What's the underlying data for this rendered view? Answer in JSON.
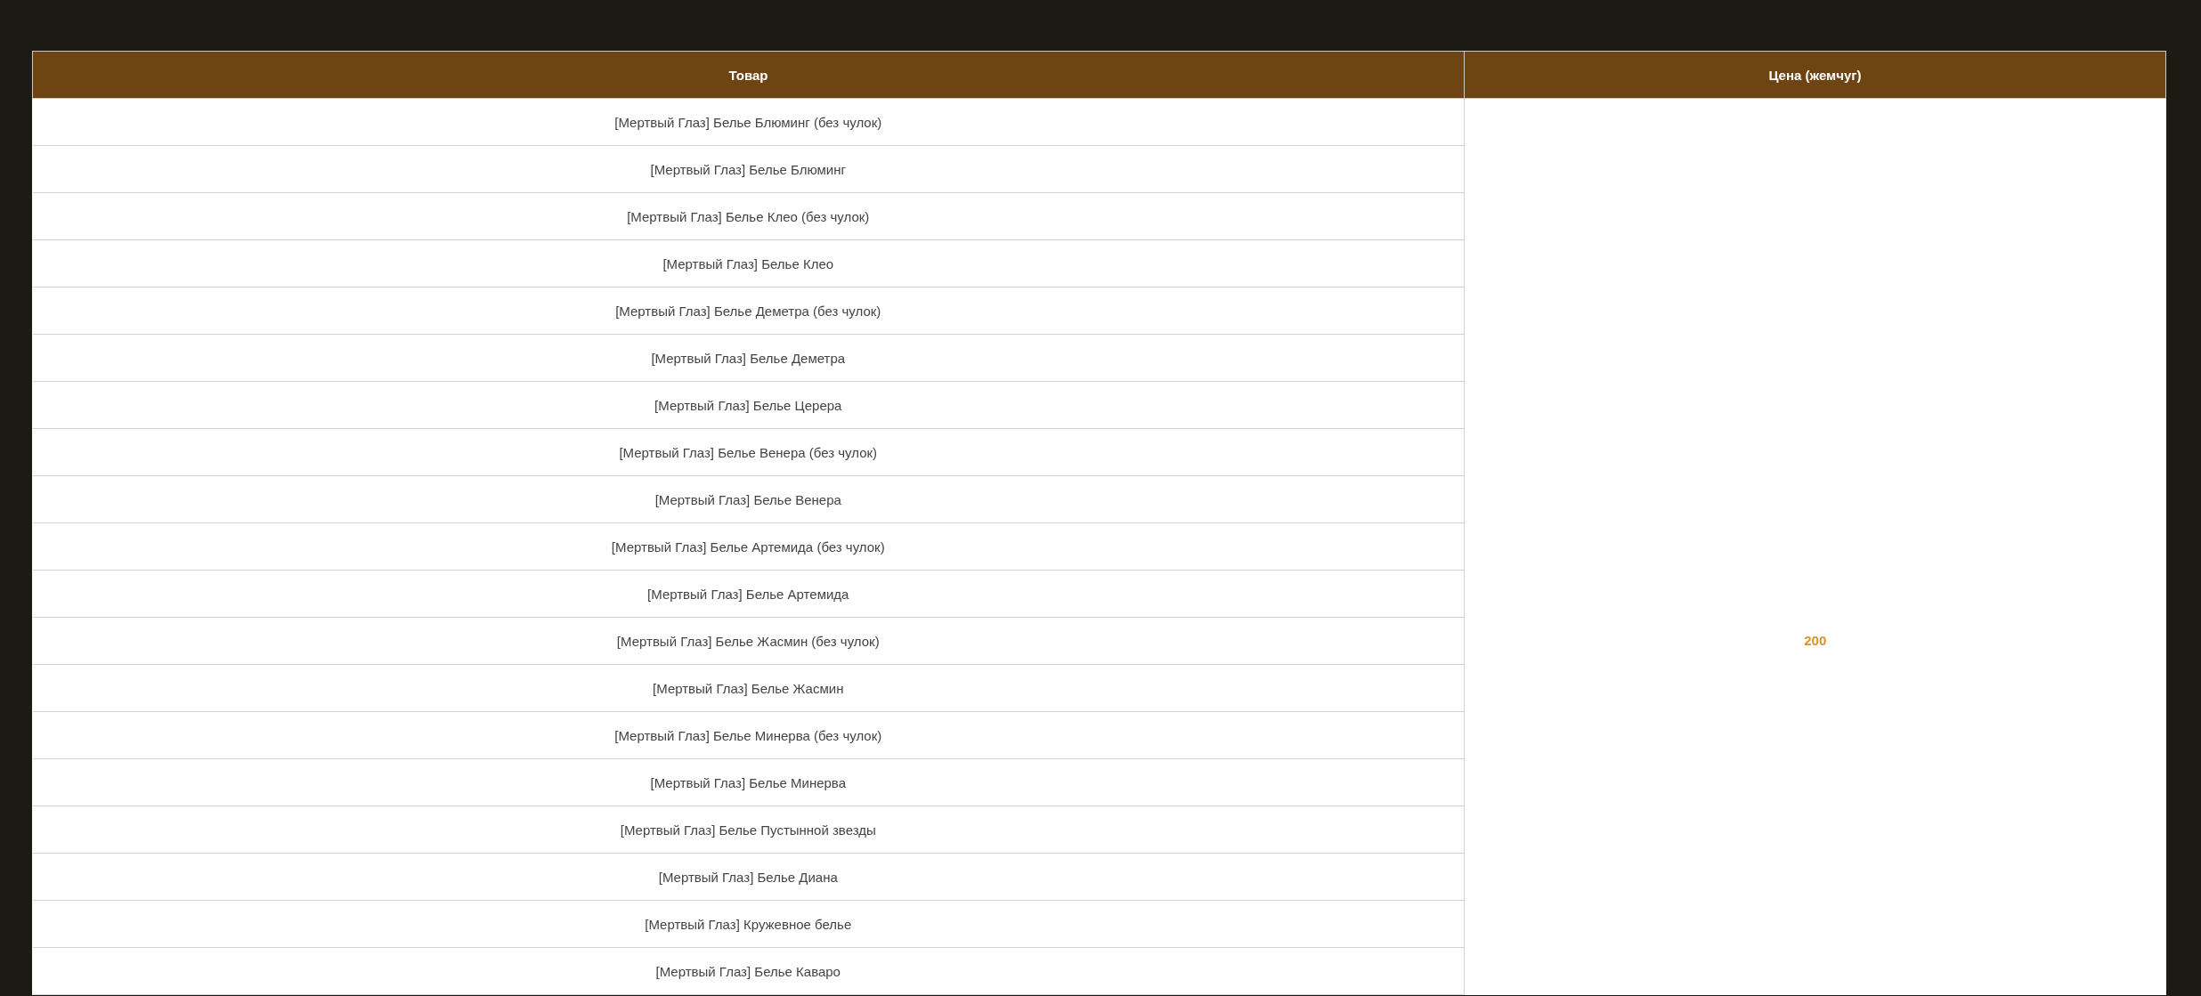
{
  "table": {
    "columns": [
      "Товар",
      "Цена (жемчуг)"
    ],
    "rows": [
      {
        "item": "[Мертвый Глаз] Белье Блюминг (без чулок)"
      },
      {
        "item": "[Мертвый Глаз] Белье Блюминг"
      },
      {
        "item": "[Мертвый Глаз] Белье Клео (без чулок)"
      },
      {
        "item": "[Мертвый Глаз] Белье Клео"
      },
      {
        "item": "[Мертвый Глаз] Белье Деметра (без чулок)"
      },
      {
        "item": "[Мертвый Глаз] Белье Деметра"
      },
      {
        "item": "[Мертвый Глаз] Белье Церера"
      },
      {
        "item": "[Мертвый Глаз] Белье Венера (без чулок)"
      },
      {
        "item": "[Мертвый Глаз] Белье Венера"
      },
      {
        "item": "[Мертвый Глаз] Белье Артемида (без чулок)"
      },
      {
        "item": "[Мертвый Глаз] Белье Артемида"
      },
      {
        "item": "[Мертвый Глаз] Белье Жасмин (без чулок)"
      },
      {
        "item": "[Мертвый Глаз] Белье Жасмин"
      },
      {
        "item": "[Мертвый Глаз] Белье Минерва (без чулок)"
      },
      {
        "item": "[Мертвый Глаз] Белье Минерва"
      },
      {
        "item": "[Мертвый Глаз] Белье Пустынной звезды"
      },
      {
        "item": "[Мертвый Глаз] Белье Диана"
      },
      {
        "item": "[Мертвый Глаз] Кружевное белье"
      },
      {
        "item": "[Мертвый Глаз] Белье Каваро"
      }
    ],
    "price": "200"
  }
}
